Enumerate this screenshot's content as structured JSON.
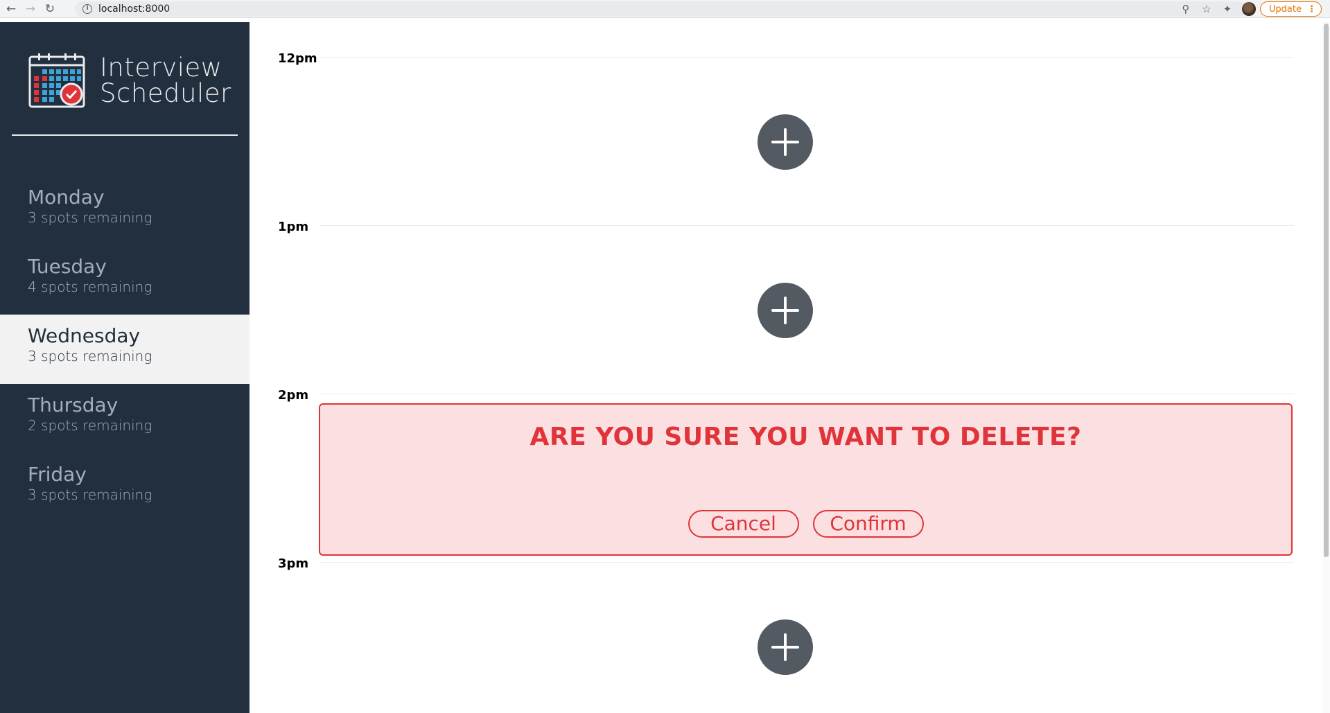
{
  "browser": {
    "url": "localhost:8000",
    "update_label": "Update"
  },
  "brand": {
    "line1": "Interview",
    "line2": "Scheduler"
  },
  "days": [
    {
      "name": "Monday",
      "spots": "3 spots remaining",
      "selected": false
    },
    {
      "name": "Tuesday",
      "spots": "4 spots remaining",
      "selected": false
    },
    {
      "name": "Wednesday",
      "spots": "3 spots remaining",
      "selected": true
    },
    {
      "name": "Thursday",
      "spots": "2 spots remaining",
      "selected": false
    },
    {
      "name": "Friday",
      "spots": "3 spots remaining",
      "selected": false
    }
  ],
  "slots": [
    {
      "time": "12pm"
    },
    {
      "time": "1pm"
    },
    {
      "time": "2pm"
    },
    {
      "time": "3pm"
    }
  ],
  "confirm": {
    "message": "ARE YOU SURE YOU WANT TO DELETE?",
    "cancel_label": "Cancel",
    "confirm_label": "Confirm"
  },
  "colors": {
    "sidebar_bg": "#222f3e",
    "add_button": "#545a62",
    "danger": "#e0343a",
    "danger_bg": "#fbdfe1",
    "update_orange": "#e37400"
  }
}
